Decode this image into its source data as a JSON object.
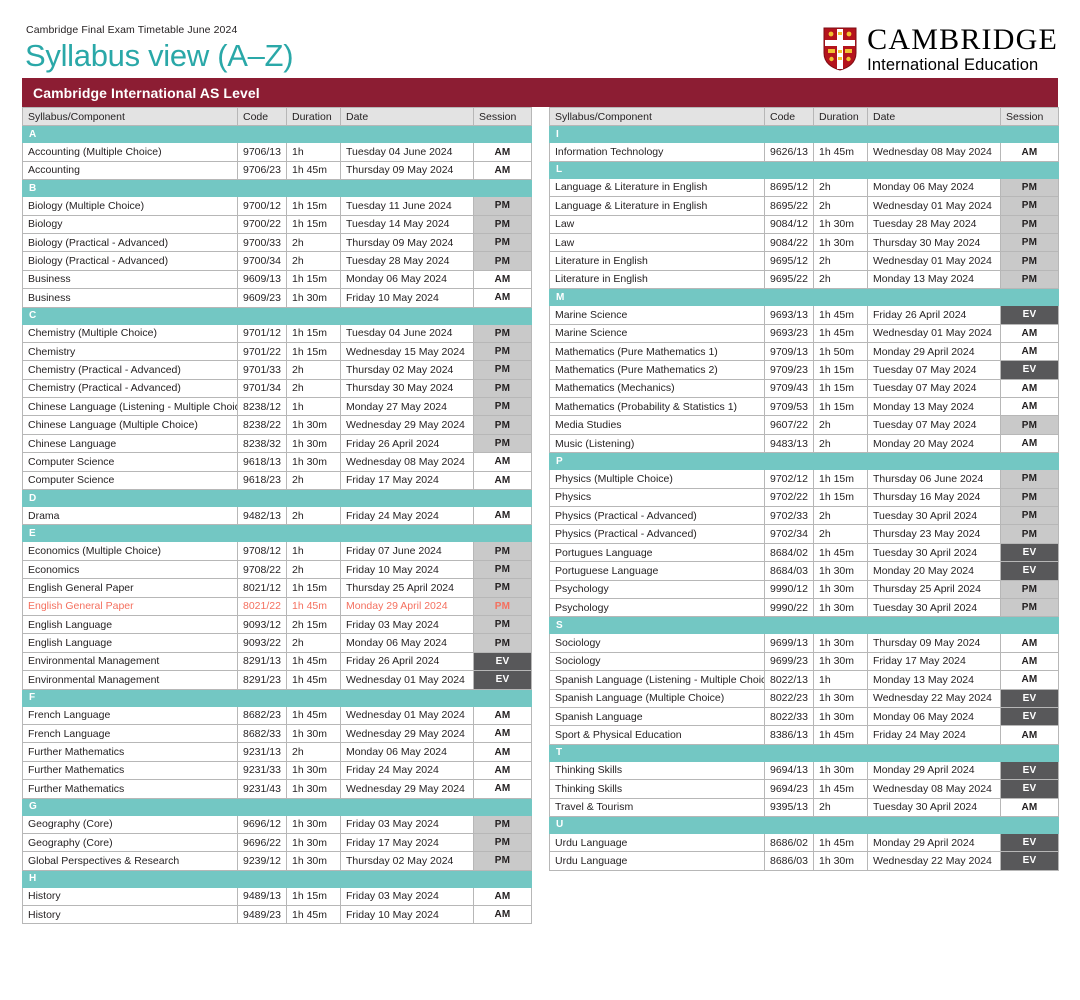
{
  "header": {
    "kicker": "Cambridge Final Exam Timetable June 2024",
    "title": "Syllabus view (A–Z)",
    "logo_primary": "CAMBRIDGE",
    "logo_secondary": "International Education",
    "crest_icon": "cambridge-crest-icon"
  },
  "qualification": {
    "banner": "Cambridge International AS Level"
  },
  "table_headers": {
    "syllabus": "Syllabus/Component",
    "code": "Code",
    "duration": "Duration",
    "date": "Date",
    "session": "Session"
  },
  "colors": {
    "banner_maroon": "#8c1d33",
    "teal_heading": "#2aa8a8",
    "letter_band_teal": "#73c7c3",
    "session_am_bg": "#ffffff",
    "session_pm_bg": "#c9c9c9",
    "session_ev_bg": "#58585a",
    "highlight_red": "#f4705f",
    "header_grey": "#e3e3e3"
  },
  "left_column": [
    {
      "letter": "A",
      "rows": [
        {
          "syllabus": "Accounting (Multiple Choice)",
          "code": "9706/13",
          "duration": "1h",
          "date": "Tuesday 04 June 2024",
          "session": "AM",
          "highlight": false
        },
        {
          "syllabus": "Accounting",
          "code": "9706/23",
          "duration": "1h 45m",
          "date": "Thursday 09 May 2024",
          "session": "AM",
          "highlight": false
        }
      ]
    },
    {
      "letter": "B",
      "rows": [
        {
          "syllabus": "Biology (Multiple Choice)",
          "code": "9700/12",
          "duration": "1h 15m",
          "date": "Tuesday 11 June 2024",
          "session": "PM",
          "highlight": false
        },
        {
          "syllabus": "Biology",
          "code": "9700/22",
          "duration": "1h 15m",
          "date": "Tuesday 14 May 2024",
          "session": "PM",
          "highlight": false
        },
        {
          "syllabus": "Biology (Practical - Advanced)",
          "code": "9700/33",
          "duration": "2h",
          "date": "Thursday 09 May 2024",
          "session": "PM",
          "highlight": false
        },
        {
          "syllabus": "Biology (Practical - Advanced)",
          "code": "9700/34",
          "duration": "2h",
          "date": "Tuesday 28 May 2024",
          "session": "PM",
          "highlight": false
        },
        {
          "syllabus": "Business",
          "code": "9609/13",
          "duration": "1h 15m",
          "date": "Monday 06 May 2024",
          "session": "AM",
          "highlight": false
        },
        {
          "syllabus": "Business",
          "code": "9609/23",
          "duration": "1h 30m",
          "date": "Friday 10 May 2024",
          "session": "AM",
          "highlight": false
        }
      ]
    },
    {
      "letter": "C",
      "rows": [
        {
          "syllabus": "Chemistry (Multiple Choice)",
          "code": "9701/12",
          "duration": "1h 15m",
          "date": "Tuesday 04 June 2024",
          "session": "PM",
          "highlight": false
        },
        {
          "syllabus": "Chemistry",
          "code": "9701/22",
          "duration": "1h 15m",
          "date": "Wednesday 15 May 2024",
          "session": "PM",
          "highlight": false
        },
        {
          "syllabus": "Chemistry (Practical - Advanced)",
          "code": "9701/33",
          "duration": "2h",
          "date": "Thursday 02 May 2024",
          "session": "PM",
          "highlight": false
        },
        {
          "syllabus": "Chemistry (Practical - Advanced)",
          "code": "9701/34",
          "duration": "2h",
          "date": "Thursday 30 May 2024",
          "session": "PM",
          "highlight": false
        },
        {
          "syllabus": "Chinese Language (Listening - Multiple Choice)",
          "code": "8238/12",
          "duration": "1h",
          "date": "Monday 27 May 2024",
          "session": "PM",
          "highlight": false
        },
        {
          "syllabus": "Chinese Language (Multiple Choice)",
          "code": "8238/22",
          "duration": "1h 30m",
          "date": "Wednesday 29 May 2024",
          "session": "PM",
          "highlight": false
        },
        {
          "syllabus": "Chinese Language",
          "code": "8238/32",
          "duration": "1h 30m",
          "date": "Friday 26 April 2024",
          "session": "PM",
          "highlight": false
        },
        {
          "syllabus": "Computer Science",
          "code": "9618/13",
          "duration": "1h 30m",
          "date": "Wednesday 08 May 2024",
          "session": "AM",
          "highlight": false
        },
        {
          "syllabus": "Computer Science",
          "code": "9618/23",
          "duration": "2h",
          "date": "Friday 17 May 2024",
          "session": "AM",
          "highlight": false
        }
      ]
    },
    {
      "letter": "D",
      "rows": [
        {
          "syllabus": "Drama",
          "code": "9482/13",
          "duration": "2h",
          "date": "Friday 24 May 2024",
          "session": "AM",
          "highlight": false
        }
      ]
    },
    {
      "letter": "E",
      "rows": [
        {
          "syllabus": "Economics (Multiple Choice)",
          "code": "9708/12",
          "duration": "1h",
          "date": "Friday 07 June 2024",
          "session": "PM",
          "highlight": false
        },
        {
          "syllabus": "Economics",
          "code": "9708/22",
          "duration": "2h",
          "date": "Friday 10 May 2024",
          "session": "PM",
          "highlight": false
        },
        {
          "syllabus": "English General Paper",
          "code": "8021/12",
          "duration": "1h 15m",
          "date": "Thursday 25 April 2024",
          "session": "PM",
          "highlight": false
        },
        {
          "syllabus": "English General Paper",
          "code": "8021/22",
          "duration": "1h 45m",
          "date": "Monday 29 April 2024",
          "session": "PM",
          "highlight": true
        },
        {
          "syllabus": "English Language",
          "code": "9093/12",
          "duration": "2h 15m",
          "date": "Friday 03 May 2024",
          "session": "PM",
          "highlight": false
        },
        {
          "syllabus": "English Language",
          "code": "9093/22",
          "duration": "2h",
          "date": "Monday 06 May 2024",
          "session": "PM",
          "highlight": false
        },
        {
          "syllabus": "Environmental Management",
          "code": "8291/13",
          "duration": "1h 45m",
          "date": "Friday 26 April 2024",
          "session": "EV",
          "highlight": false
        },
        {
          "syllabus": "Environmental Management",
          "code": "8291/23",
          "duration": "1h 45m",
          "date": "Wednesday 01 May 2024",
          "session": "EV",
          "highlight": false
        }
      ]
    },
    {
      "letter": "F",
      "rows": [
        {
          "syllabus": "French Language",
          "code": "8682/23",
          "duration": "1h 45m",
          "date": "Wednesday 01 May 2024",
          "session": "AM",
          "highlight": false
        },
        {
          "syllabus": "French Language",
          "code": "8682/33",
          "duration": "1h 30m",
          "date": "Wednesday 29 May 2024",
          "session": "AM",
          "highlight": false
        },
        {
          "syllabus": "Further Mathematics",
          "code": "9231/13",
          "duration": "2h",
          "date": "Monday 06 May 2024",
          "session": "AM",
          "highlight": false
        },
        {
          "syllabus": "Further Mathematics",
          "code": "9231/33",
          "duration": "1h 30m",
          "date": "Friday 24 May 2024",
          "session": "AM",
          "highlight": false
        },
        {
          "syllabus": "Further Mathematics",
          "code": "9231/43",
          "duration": "1h 30m",
          "date": "Wednesday 29 May 2024",
          "session": "AM",
          "highlight": false
        }
      ]
    },
    {
      "letter": "G",
      "rows": [
        {
          "syllabus": "Geography (Core)",
          "code": "9696/12",
          "duration": "1h 30m",
          "date": "Friday 03 May 2024",
          "session": "PM",
          "highlight": false
        },
        {
          "syllabus": "Geography (Core)",
          "code": "9696/22",
          "duration": "1h 30m",
          "date": "Friday 17 May 2024",
          "session": "PM",
          "highlight": false
        },
        {
          "syllabus": "Global Perspectives & Research",
          "code": "9239/12",
          "duration": "1h 30m",
          "date": "Thursday 02 May 2024",
          "session": "PM",
          "highlight": false
        }
      ]
    },
    {
      "letter": "H",
      "rows": [
        {
          "syllabus": "History",
          "code": "9489/13",
          "duration": "1h 15m",
          "date": "Friday 03 May 2024",
          "session": "AM",
          "highlight": false
        },
        {
          "syllabus": "History",
          "code": "9489/23",
          "duration": "1h 45m",
          "date": "Friday 10 May 2024",
          "session": "AM",
          "highlight": false
        }
      ]
    }
  ],
  "right_column": [
    {
      "letter": "I",
      "rows": [
        {
          "syllabus": "Information Technology",
          "code": "9626/13",
          "duration": "1h 45m",
          "date": "Wednesday 08 May 2024",
          "session": "AM",
          "highlight": false
        }
      ]
    },
    {
      "letter": "L",
      "rows": [
        {
          "syllabus": "Language & Literature in English",
          "code": "8695/12",
          "duration": "2h",
          "date": "Monday 06 May 2024",
          "session": "PM",
          "highlight": false
        },
        {
          "syllabus": "Language & Literature in English",
          "code": "8695/22",
          "duration": "2h",
          "date": "Wednesday 01 May 2024",
          "session": "PM",
          "highlight": false
        },
        {
          "syllabus": "Law",
          "code": "9084/12",
          "duration": "1h 30m",
          "date": "Tuesday 28 May 2024",
          "session": "PM",
          "highlight": false
        },
        {
          "syllabus": "Law",
          "code": "9084/22",
          "duration": "1h 30m",
          "date": "Thursday 30 May 2024",
          "session": "PM",
          "highlight": false
        },
        {
          "syllabus": "Literature in English",
          "code": "9695/12",
          "duration": "2h",
          "date": "Wednesday 01 May 2024",
          "session": "PM",
          "highlight": false
        },
        {
          "syllabus": "Literature in English",
          "code": "9695/22",
          "duration": "2h",
          "date": "Monday 13 May 2024",
          "session": "PM",
          "highlight": false
        }
      ]
    },
    {
      "letter": "M",
      "rows": [
        {
          "syllabus": "Marine Science",
          "code": "9693/13",
          "duration": "1h 45m",
          "date": "Friday 26 April 2024",
          "session": "EV",
          "highlight": false
        },
        {
          "syllabus": "Marine Science",
          "code": "9693/23",
          "duration": "1h 45m",
          "date": "Wednesday 01 May 2024",
          "session": "AM",
          "highlight": false
        },
        {
          "syllabus": "Mathematics (Pure Mathematics 1)",
          "code": "9709/13",
          "duration": "1h 50m",
          "date": "Monday 29 April 2024",
          "session": "AM",
          "highlight": false
        },
        {
          "syllabus": "Mathematics (Pure Mathematics 2)",
          "code": "9709/23",
          "duration": "1h 15m",
          "date": "Tuesday 07 May 2024",
          "session": "EV",
          "highlight": false
        },
        {
          "syllabus": "Mathematics (Mechanics)",
          "code": "9709/43",
          "duration": "1h 15m",
          "date": "Tuesday 07 May 2024",
          "session": "AM",
          "highlight": false
        },
        {
          "syllabus": "Mathematics (Probability & Statistics 1)",
          "code": "9709/53",
          "duration": "1h 15m",
          "date": "Monday 13 May 2024",
          "session": "AM",
          "highlight": false
        },
        {
          "syllabus": "Media Studies",
          "code": "9607/22",
          "duration": "2h",
          "date": "Tuesday 07 May 2024",
          "session": "PM",
          "highlight": false
        },
        {
          "syllabus": "Music (Listening)",
          "code": "9483/13",
          "duration": "2h",
          "date": "Monday 20 May 2024",
          "session": "AM",
          "highlight": false
        }
      ]
    },
    {
      "letter": "P",
      "rows": [
        {
          "syllabus": "Physics (Multiple Choice)",
          "code": "9702/12",
          "duration": "1h 15m",
          "date": "Thursday 06 June 2024",
          "session": "PM",
          "highlight": false
        },
        {
          "syllabus": "Physics",
          "code": "9702/22",
          "duration": "1h 15m",
          "date": "Thursday 16 May 2024",
          "session": "PM",
          "highlight": false
        },
        {
          "syllabus": "Physics (Practical - Advanced)",
          "code": "9702/33",
          "duration": "2h",
          "date": "Tuesday 30 April 2024",
          "session": "PM",
          "highlight": false
        },
        {
          "syllabus": "Physics (Practical - Advanced)",
          "code": "9702/34",
          "duration": "2h",
          "date": "Thursday 23 May 2024",
          "session": "PM",
          "highlight": false
        },
        {
          "syllabus": "Portugues Language",
          "code": "8684/02",
          "duration": "1h 45m",
          "date": "Tuesday 30 April 2024",
          "session": "EV",
          "highlight": false
        },
        {
          "syllabus": "Portuguese Language",
          "code": "8684/03",
          "duration": "1h 30m",
          "date": "Monday 20 May 2024",
          "session": "EV",
          "highlight": false
        },
        {
          "syllabus": "Psychology",
          "code": "9990/12",
          "duration": "1h 30m",
          "date": "Thursday 25 April 2024",
          "session": "PM",
          "highlight": false
        },
        {
          "syllabus": "Psychology",
          "code": "9990/22",
          "duration": "1h 30m",
          "date": "Tuesday 30 April 2024",
          "session": "PM",
          "highlight": false
        }
      ]
    },
    {
      "letter": "S",
      "rows": [
        {
          "syllabus": "Sociology",
          "code": "9699/13",
          "duration": "1h 30m",
          "date": "Thursday 09 May 2024",
          "session": "AM",
          "highlight": false
        },
        {
          "syllabus": "Sociology",
          "code": "9699/23",
          "duration": "1h 30m",
          "date": "Friday 17 May 2024",
          "session": "AM",
          "highlight": false
        },
        {
          "syllabus": "Spanish Language (Listening - Multiple Choice)",
          "code": "8022/13",
          "duration": "1h",
          "date": "Monday 13 May 2024",
          "session": "AM",
          "highlight": false
        },
        {
          "syllabus": "Spanish Language (Multiple Choice)",
          "code": "8022/23",
          "duration": "1h 30m",
          "date": "Wednesday 22 May 2024",
          "session": "EV",
          "highlight": false
        },
        {
          "syllabus": "Spanish Language",
          "code": "8022/33",
          "duration": "1h 30m",
          "date": "Monday 06 May 2024",
          "session": "EV",
          "highlight": false
        },
        {
          "syllabus": "Sport & Physical Education",
          "code": "8386/13",
          "duration": "1h 45m",
          "date": "Friday 24 May 2024",
          "session": "AM",
          "highlight": false
        }
      ]
    },
    {
      "letter": "T",
      "rows": [
        {
          "syllabus": "Thinking Skills",
          "code": "9694/13",
          "duration": "1h 30m",
          "date": "Monday 29 April 2024",
          "session": "EV",
          "highlight": false
        },
        {
          "syllabus": "Thinking Skills",
          "code": "9694/23",
          "duration": "1h 45m",
          "date": "Wednesday 08 May 2024",
          "session": "EV",
          "highlight": false
        },
        {
          "syllabus": "Travel & Tourism",
          "code": "9395/13",
          "duration": "2h",
          "date": "Tuesday 30 April 2024",
          "session": "AM",
          "highlight": false
        }
      ]
    },
    {
      "letter": "U",
      "rows": [
        {
          "syllabus": "Urdu Language",
          "code": "8686/02",
          "duration": "1h 45m",
          "date": "Monday 29 April 2024",
          "session": "EV",
          "highlight": false
        },
        {
          "syllabus": "Urdu Language",
          "code": "8686/03",
          "duration": "1h 30m",
          "date": "Wednesday 22 May 2024",
          "session": "EV",
          "highlight": false
        }
      ]
    }
  ]
}
